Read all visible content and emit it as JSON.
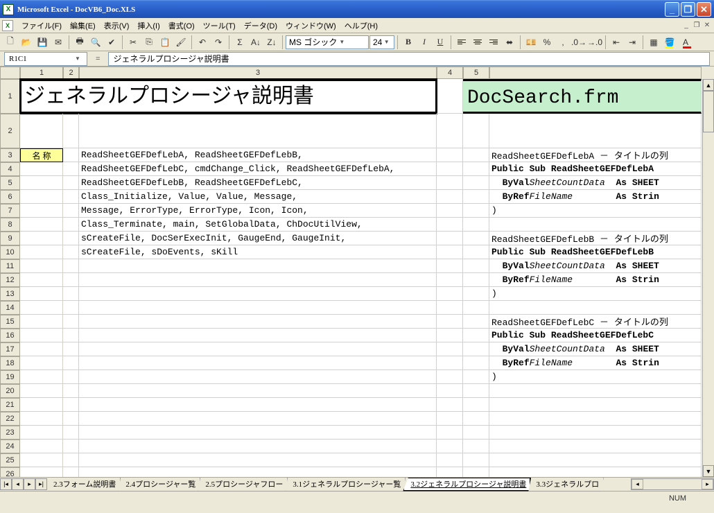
{
  "window": {
    "title": "Microsoft Excel - DocVB6_Doc.XLS"
  },
  "menu": [
    "ファイル(F)",
    "編集(E)",
    "表示(V)",
    "挿入(I)",
    "書式(O)",
    "ツール(T)",
    "データ(D)",
    "ウィンドウ(W)",
    "ヘルプ(H)"
  ],
  "toolbar": {
    "font_name": "MS ゴシック",
    "font_size": "24"
  },
  "namebox": "R1C1",
  "formula": "ジェネラルプロシージャ説明書",
  "col_heads": [
    "1",
    "2",
    "3",
    "4",
    "5"
  ],
  "title_cells": {
    "a": "ジェネラルプロシージャ説明書",
    "b": "DocSearch.frm"
  },
  "name_label": "名 称",
  "left_lines": [
    "ReadSheetGEFDefLebA, ReadSheetGEFDefLebB,",
    "ReadSheetGEFDefLebC, cmdChange_Click, ReadSheetGEFDefLebA,",
    "ReadSheetGEFDefLebB, ReadSheetGEFDefLebC,",
    "Class_Initialize, Value, Value, Message,",
    "Message, ErrorType, ErrorType, Icon, Icon,",
    "Class_Terminate, main, SetGlobalData, ChDocUtilView,",
    "sCreateFile, DocSerExecInit, GaugeEnd, GaugeInit,",
    "sCreateFile, sDoEvents, sKill"
  ],
  "right_lines": [
    {
      "t": "ReadSheetGEFDefLebA － タイトルの列"
    },
    {
      "html": "<span class='kw'>Public Sub ReadSheetGEFDefLebA</span>"
    },
    {
      "html": "&nbsp;&nbsp;<span class='kw'>ByVal</span> <span class='it'>SheetCountData</span>&nbsp;&nbsp;<span class='kw'>As SHEET</span>"
    },
    {
      "html": "&nbsp;&nbsp;<span class='kw'>ByRef</span> <span class='it'>FileName</span>&nbsp;&nbsp;&nbsp;&nbsp;&nbsp;&nbsp;&nbsp;&nbsp;<span class='kw'>As Strin</span>"
    },
    {
      "t": ")"
    },
    {
      "t": ""
    },
    {
      "t": "ReadSheetGEFDefLebB － タイトルの列"
    },
    {
      "html": "<span class='kw'>Public Sub ReadSheetGEFDefLebB</span>"
    },
    {
      "html": "&nbsp;&nbsp;<span class='kw'>ByVal</span> <span class='it'>SheetCountData</span>&nbsp;&nbsp;<span class='kw'>As SHEET</span>"
    },
    {
      "html": "&nbsp;&nbsp;<span class='kw'>ByRef</span> <span class='it'>FileName</span>&nbsp;&nbsp;&nbsp;&nbsp;&nbsp;&nbsp;&nbsp;&nbsp;<span class='kw'>As Strin</span>"
    },
    {
      "t": ")"
    },
    {
      "t": ""
    },
    {
      "t": "ReadSheetGEFDefLebC － タイトルの列"
    },
    {
      "html": "<span class='kw'>Public Sub ReadSheetGEFDefLebC</span>"
    },
    {
      "html": "&nbsp;&nbsp;<span class='kw'>ByVal</span> <span class='it'>SheetCountData</span>&nbsp;&nbsp;<span class='kw'>As SHEET</span>"
    },
    {
      "html": "&nbsp;&nbsp;<span class='kw'>ByRef</span> <span class='it'>FileName</span>&nbsp;&nbsp;&nbsp;&nbsp;&nbsp;&nbsp;&nbsp;&nbsp;<span class='kw'>As Strin</span>"
    },
    {
      "t": ")"
    }
  ],
  "sheet_tabs": [
    "2.3フォーム説明書",
    "2.4プロシージャー覧",
    "2.5プロシージャフロー",
    "3.1ジェネラルプロシージャー覧",
    "3.2ジェネラルプロシージャ説明書",
    "3.3ジェネラルプロ"
  ],
  "active_tab": 4,
  "status": "NUM"
}
